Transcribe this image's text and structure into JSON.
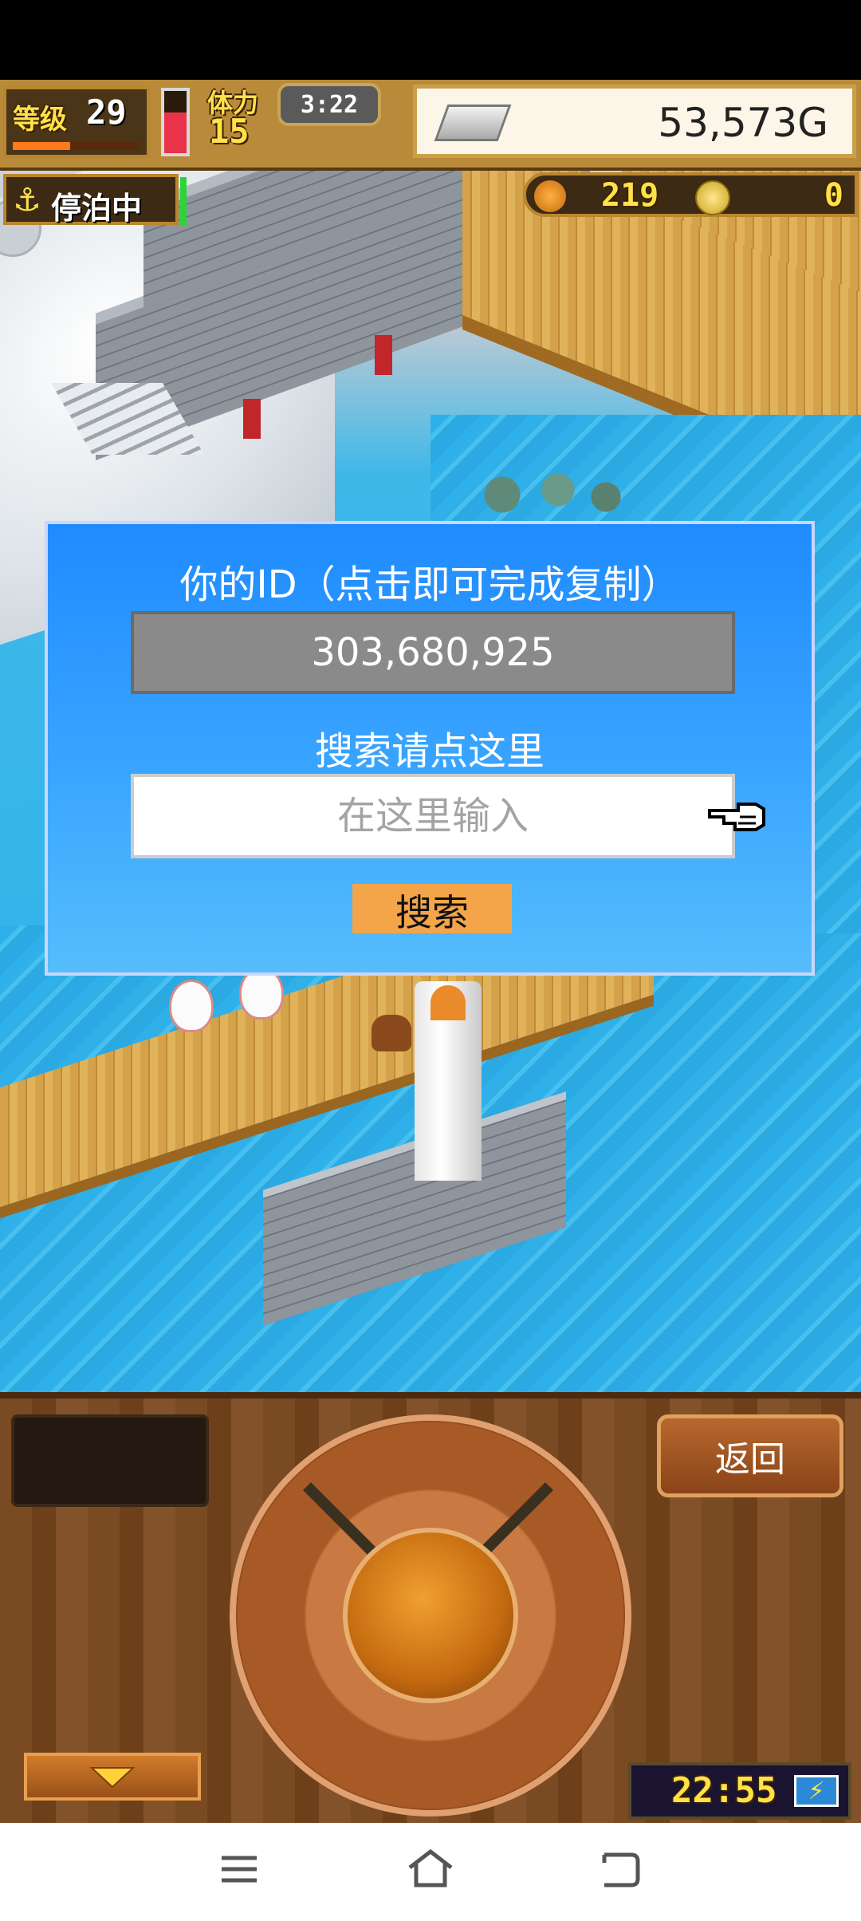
{
  "hud": {
    "level_label": "等级",
    "level_value": "29",
    "stamina_label": "体力",
    "stamina_value": "15",
    "timer": "3:22",
    "gold": "53,573G",
    "docked_label": "停泊中",
    "medals": "219",
    "coins": "0",
    "stamina_fill": 0.65,
    "level_progress": 0.45
  },
  "dialog": {
    "id_title": "你的ID（点击即可完成复制）",
    "id_value": "303,680,925",
    "search_title": "搜索请点这里",
    "search_placeholder": "在这里输入",
    "search_button": "搜索"
  },
  "controls": {
    "back_button": "返回",
    "clock": "22:55"
  },
  "colors": {
    "dialog_bg": "#2a93ff",
    "search_button": "#f4a54a",
    "hud_gold_text": "#ffe14a"
  },
  "icons": {
    "nav_menu": "menu-icon",
    "nav_home": "home-icon",
    "nav_back": "back-icon"
  }
}
